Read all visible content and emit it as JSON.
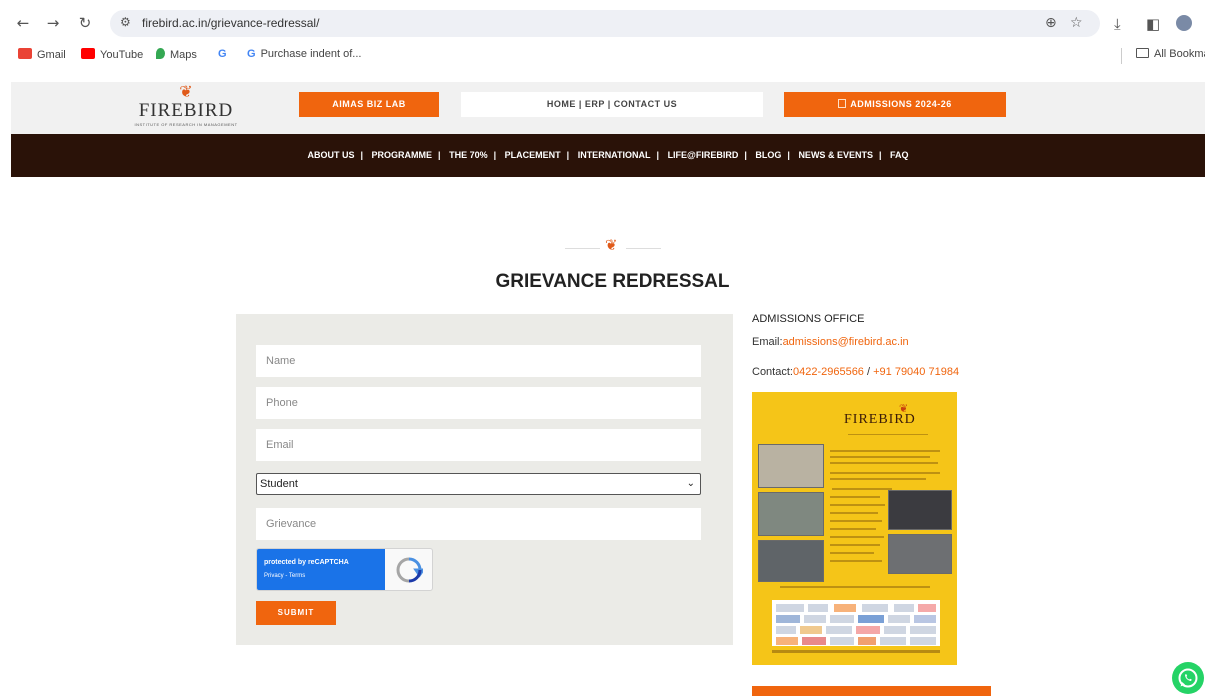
{
  "browser": {
    "url": "firebird.ac.in/grievance-redressal/",
    "bookmarks": [
      {
        "label": "Gmail",
        "color": "#ea4335"
      },
      {
        "label": "YouTube",
        "color": "#ff0000"
      },
      {
        "label": "Maps",
        "color": "#34a853"
      },
      {
        "label": "G",
        "color": "#4285f4"
      },
      {
        "label": "Purchase indent of...",
        "color": "#4285f4"
      }
    ],
    "all_bookmarks": "All Bookma"
  },
  "header": {
    "logo_text": "FIREBIRD",
    "logo_sub": "INSTITUTE OF RESEARCH IN MANAGEMENT",
    "btn_bizlab": "AIMAS BIZ LAB",
    "btn_links": "HOME | ERP | CONTACT US",
    "btn_admissions": "ADMISSIONS 2024-26"
  },
  "nav": [
    "ABOUT US",
    "PROGRAMME",
    "THE 70%",
    "PLACEMENT",
    "INTERNATIONAL",
    "LIFE@FIREBIRD",
    "BLOG",
    "NEWS & EVENTS",
    "FAQ"
  ],
  "page": {
    "title": "GRIEVANCE REDRESSAL"
  },
  "form": {
    "name_placeholder": "Name",
    "phone_placeholder": "Phone",
    "email_placeholder": "Email",
    "category_selected": "Student",
    "grievance_placeholder": "Grievance",
    "recaptcha_line1": "protected by reCAPTCHA",
    "recaptcha_line2": "Privacy - Terms",
    "submit_label": "SUBMIT"
  },
  "sidebar": {
    "heading": "ADMISSIONS OFFICE",
    "email_label": "Email:",
    "email_value": "admissions@firebird.ac.in",
    "contact_label": "Contact:",
    "phone1": "0422-2965566",
    "phone_sep": " / ",
    "phone2": "+91 79040 71984"
  },
  "poster": {
    "title": "FIREBIRD"
  },
  "colors": {
    "accent": "#f0650e",
    "nav_bg": "#2a1208",
    "poster_bg": "#f5c518"
  }
}
